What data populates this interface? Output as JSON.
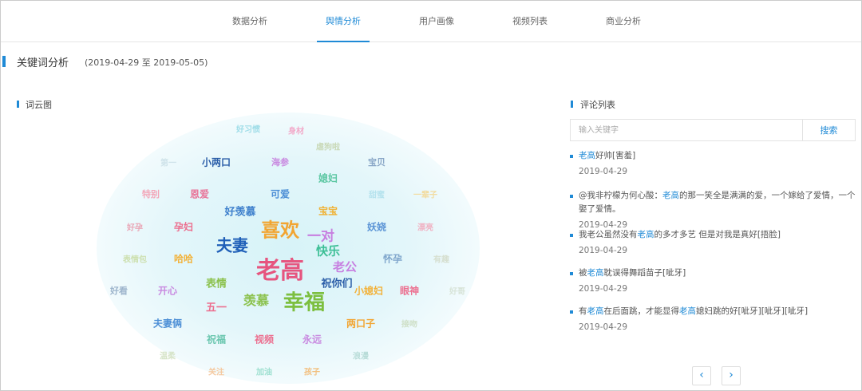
{
  "nav": {
    "tabs": [
      {
        "label": "数据分析"
      },
      {
        "label": "舆情分析"
      },
      {
        "label": "用户画像"
      },
      {
        "label": "视频列表"
      },
      {
        "label": "商业分析"
      }
    ],
    "active": 1
  },
  "section": {
    "title": "关键词分析",
    "range": "(2019-04-29 至 2019-05-05)"
  },
  "cloud": {
    "title": "词云图",
    "words": [
      {
        "t": "好习惯",
        "c": "#9fdde8"
      },
      {
        "t": "身材",
        "c": "#f2a9c9"
      },
      {
        "t": "虐狗啦",
        "c": "#c9d9b8"
      },
      {
        "t": "第一",
        "c": "#cfe3ea"
      },
      {
        "t": "小两口",
        "c": "#2b5ea8"
      },
      {
        "t": "海参",
        "c": "#c98ae0"
      },
      {
        "t": "宝贝",
        "c": "#8aa7c7"
      },
      {
        "t": "媳妇",
        "c": "#5cc7a3"
      },
      {
        "t": "特别",
        "c": "#f3a6b8"
      },
      {
        "t": "恩爱",
        "c": "#e8769a"
      },
      {
        "t": "可爱",
        "c": "#4d8fd6"
      },
      {
        "t": "甜蜜",
        "c": "#b6e3ee"
      },
      {
        "t": "一辈子",
        "c": "#f2dca0"
      },
      {
        "t": "好羡慕",
        "c": "#3d7fcc"
      },
      {
        "t": "宝宝",
        "c": "#f0b030"
      },
      {
        "t": "好孕",
        "c": "#e9a6b6"
      },
      {
        "t": "孕妇",
        "c": "#ec6f8f"
      },
      {
        "t": "喜欢",
        "c": "#f2a532"
      },
      {
        "t": "一对",
        "c": "#c77fe0"
      },
      {
        "t": "妖娆",
        "c": "#5c95d6"
      },
      {
        "t": "漂亮",
        "c": "#f0b3c4"
      },
      {
        "t": "夫妻",
        "c": "#1f5fb8"
      },
      {
        "t": "快乐",
        "c": "#3dbf96"
      },
      {
        "t": "表情包",
        "c": "#cde0b0"
      },
      {
        "t": "哈哈",
        "c": "#f2b23a"
      },
      {
        "t": "怀孕",
        "c": "#7fa6cc"
      },
      {
        "t": "有趣",
        "c": "#d6dfd0"
      },
      {
        "t": "老高",
        "c": "#e6557f"
      },
      {
        "t": "老公",
        "c": "#c77fe0"
      },
      {
        "t": "祝你们",
        "c": "#2b5ea8"
      },
      {
        "t": "表情",
        "c": "#8cc24f"
      },
      {
        "t": "好看",
        "c": "#9eb5cc"
      },
      {
        "t": "开心",
        "c": "#c98ae0"
      },
      {
        "t": "小媳妇",
        "c": "#f2b23a"
      },
      {
        "t": "眼神",
        "c": "#ec6f8f"
      },
      {
        "t": "好哥",
        "c": "#d8e4d8"
      },
      {
        "t": "羡慕",
        "c": "#8cc24f"
      },
      {
        "t": "幸福",
        "c": "#7cbf3f"
      },
      {
        "t": "五一",
        "c": "#ec6f8f"
      },
      {
        "t": "夫妻俩",
        "c": "#4d8fd6"
      },
      {
        "t": "两口子",
        "c": "#f2a532"
      },
      {
        "t": "接吻",
        "c": "#cfe0c8"
      },
      {
        "t": "祝福",
        "c": "#6cc7b0"
      },
      {
        "t": "视频",
        "c": "#ec6f8f"
      },
      {
        "t": "永远",
        "c": "#c98ae0"
      },
      {
        "t": "温柔",
        "c": "#d6e4c8"
      },
      {
        "t": "浪漫",
        "c": "#b8dcd8"
      },
      {
        "t": "关注",
        "c": "#f5c9a0"
      },
      {
        "t": "加油",
        "c": "#9ee0d0"
      },
      {
        "t": "孩子",
        "c": "#f2c080"
      }
    ]
  },
  "comments": {
    "title": "评论列表",
    "search_placeholder": "输入关键字",
    "search_label": "搜索",
    "highlight": "老高",
    "items": [
      {
        "parts": [
          "",
          "老高",
          "好帅[害羞]"
        ],
        "date": "2019-04-29"
      },
      {
        "parts": [
          "@我非柠檬为何心酸：",
          "老高",
          "的那一笑全是满满的爱，一个嫁给了爱情，一个娶了爱情。"
        ],
        "date": "2019-04-29"
      },
      {
        "parts": [
          "我老公虽然没有",
          "老高",
          "的多才多艺 但是对我是真好[捂脸]"
        ],
        "date": "2019-04-29"
      },
      {
        "parts": [
          "被",
          "老高",
          "耽误得舞蹈苗子[呲牙]"
        ],
        "date": "2019-04-29"
      },
      {
        "parts": [
          "有",
          "老高",
          "在后面跳，才能显得",
          "老高",
          "媳妇跳的好[呲牙][呲牙][呲牙]"
        ],
        "date": "2019-04-29"
      }
    ],
    "prev_icon": "chevron-left-icon",
    "next_icon": "chevron-right-icon"
  }
}
